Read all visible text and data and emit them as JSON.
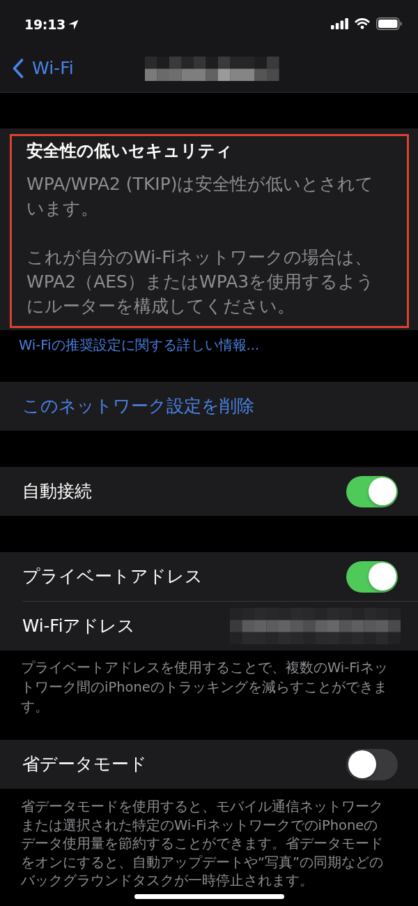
{
  "status_bar": {
    "time": "19:13"
  },
  "nav": {
    "back_label": "Wi-Fi"
  },
  "security_warning": {
    "highlighted": true,
    "title": "安全性の低いセキュリティ",
    "paragraphs": [
      "WPA/WPA2 (TKIP)は安全性が低いとされています。",
      "これが自分のWi-Fiネットワークの場合は、WPA2（AES）またはWPA3を使用するようにルーターを構成してください。"
    ],
    "link": "Wi-Fiの推奨設定に関する詳しい情報..."
  },
  "sections": [
    {
      "rows": [
        {
          "kind": "action",
          "label": "このネットワーク設定を削除"
        }
      ]
    },
    {
      "rows": [
        {
          "kind": "toggle",
          "label": "自動接続",
          "on": true
        }
      ]
    },
    {
      "rows": [
        {
          "kind": "toggle",
          "label": "プライベートアドレス",
          "on": true
        },
        {
          "kind": "masked",
          "label": "Wi-Fiアドレス"
        }
      ],
      "footer": "プライベートアドレスを使用することで、複数のWi-Fiネットワーク間のiPhoneのトラッキングを減らすことができます。"
    },
    {
      "rows": [
        {
          "kind": "toggle",
          "label": "省データモード",
          "on": false
        }
      ],
      "footer": "省データモードを使用すると、モバイル通信ネットワークまたは選択された特定のWi-FiネットワークでのiPhoneのデータ使用量を節約することができます。省データモードをオンにすると、自動アップデートや“写真”の同期などのバックグラウンドタスクが一時停止されます。"
    }
  ]
}
